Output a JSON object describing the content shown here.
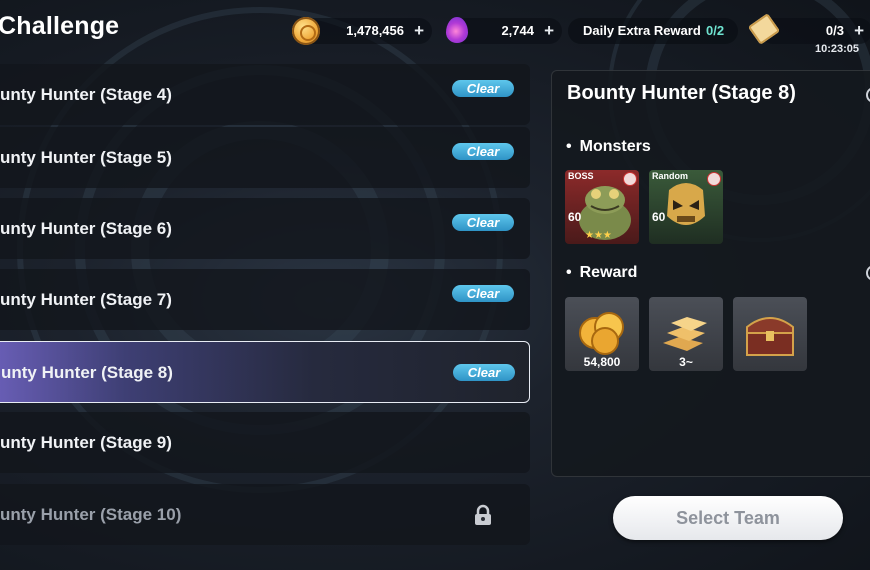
{
  "header": {
    "title": "Challenge",
    "gold": "1,478,456",
    "gems": "2,744",
    "daily_label": "Daily Extra Reward",
    "daily_count": "0/2",
    "tickets": "0/3",
    "timer": "10:23:05",
    "plus": "+"
  },
  "stages": [
    {
      "label": "unty Hunter (Stage 4)",
      "status": "Clear"
    },
    {
      "label": "unty Hunter (Stage 5)",
      "status": "Clear"
    },
    {
      "label": "unty Hunter (Stage 6)",
      "status": "Clear"
    },
    {
      "label": "unty Hunter (Stage 7)",
      "status": "Clear"
    },
    {
      "label": "unty Hunter (Stage 8)",
      "status": "Clear"
    },
    {
      "label": "unty Hunter (Stage 9)",
      "status": ""
    },
    {
      "label": "unty Hunter (Stage 10)",
      "status": "locked"
    }
  ],
  "detail": {
    "title": "Bounty Hunter (Stage 8)",
    "monsters_label": "Monsters",
    "reward_label": "Reward",
    "monsters": [
      {
        "tag": "BOSS",
        "level": "60",
        "stars": 3
      },
      {
        "tag": "Random",
        "level": "60"
      }
    ],
    "rewards": [
      {
        "icon": "gold-coins-icon",
        "count": "54,800"
      },
      {
        "icon": "gold-bars-icon",
        "count": "3~"
      },
      {
        "icon": "treasure-chest-icon",
        "count": ""
      }
    ]
  },
  "select_team": "Select Team",
  "colors": {
    "clear_badge": "#3aa6d6",
    "daily_count": "#6fe3d0"
  }
}
